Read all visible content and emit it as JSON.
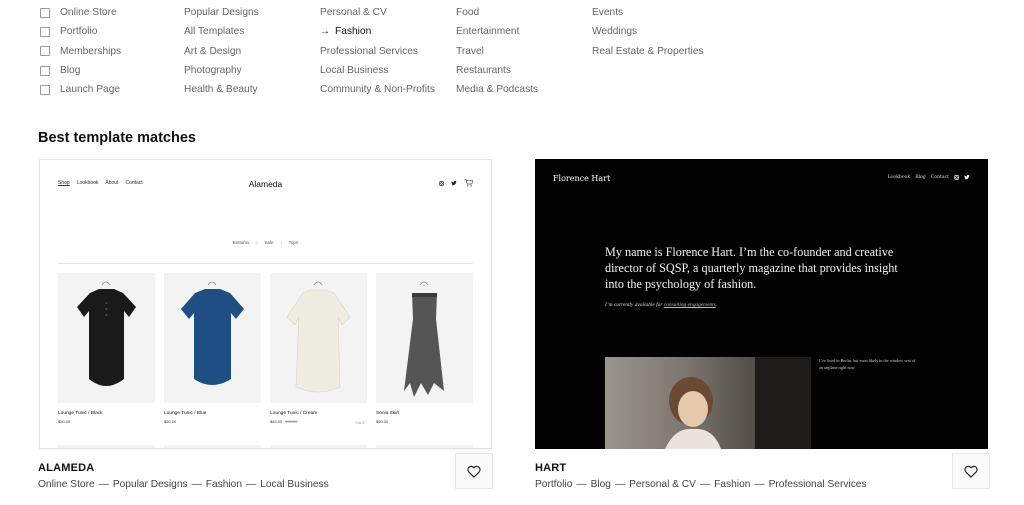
{
  "filters": {
    "types": [
      {
        "label": "Online Store",
        "checked": false
      },
      {
        "label": "Portfolio",
        "checked": false
      },
      {
        "label": "Memberships",
        "checked": false
      },
      {
        "label": "Blog",
        "checked": false
      },
      {
        "label": "Launch Page",
        "checked": false
      }
    ],
    "topics_col1": [
      "Popular Designs",
      "All Templates",
      "Art & Design",
      "Photography",
      "Health & Beauty"
    ],
    "topics_col2": [
      "Personal & CV",
      "Fashion",
      "Professional Services",
      "Local Business",
      "Community & Non-Profits"
    ],
    "topics_col3": [
      "Food",
      "Entertainment",
      "Travel",
      "Restaurants",
      "Media & Podcasts"
    ],
    "topics_col4": [
      "Events",
      "Weddings",
      "Real Estate & Properties"
    ],
    "selected_topic": "Fashion",
    "selected_arrow": "→"
  },
  "section_title": "Best template matches",
  "templates": [
    {
      "name": "ALAMEDA",
      "tags": [
        "Online Store",
        "Popular Designs",
        "Fashion",
        "Local Business"
      ],
      "preview": {
        "brand": "Alameda",
        "nav": [
          "Shop",
          "Lookbook",
          "About",
          "Contact"
        ],
        "categories": [
          "Bottoms",
          "Sale",
          "Tops"
        ],
        "products": [
          {
            "name": "Lounge Tunic / Black",
            "price": "$50.00",
            "old_price": "",
            "sale": "",
            "color": "#1a1a1a"
          },
          {
            "name": "Lounge Tunic / Blue",
            "price": "$50.00",
            "old_price": "",
            "sale": "",
            "color": "#1f4f82"
          },
          {
            "name": "Lounge Tunic / Cream",
            "price": "$45.00",
            "old_price": "$68.00",
            "sale": "SALE",
            "color": "#efece2"
          },
          {
            "name": "Sonia Skirt",
            "price": "$50.00",
            "old_price": "",
            "sale": "",
            "color": "#555555"
          }
        ]
      }
    },
    {
      "name": "HART",
      "tags": [
        "Portfolio",
        "Blog",
        "Personal & CV",
        "Fashion",
        "Professional Services"
      ],
      "preview": {
        "brand": "Florence Hart",
        "nav": [
          "Lookbook",
          "Blog",
          "Contact"
        ],
        "intro": "My name is Florence Hart. I’m the co-founder and creative director of SQSP, a quarterly magazine that provides insight into the psychology of fashion.",
        "availability_prefix": "I’m currently available for",
        "availability_link": "consulting engagements",
        "availability_suffix": ".",
        "side_text": "I’ve lived in Berlin, but most likely in the window seat of an airplane right now."
      }
    }
  ],
  "dash": "—",
  "colors": {
    "accent_text": "#111111",
    "muted_text": "#666666",
    "hart_bg": "#020202"
  }
}
